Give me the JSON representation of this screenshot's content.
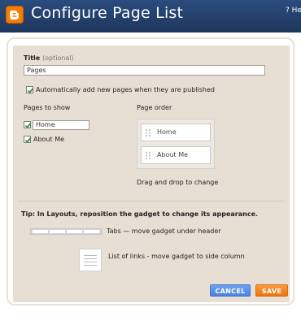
{
  "header": {
    "title": "Configure Page List",
    "help_link": "? Help"
  },
  "form": {
    "title_label": "Title",
    "title_optional": "(optional)",
    "title_value": "Pages",
    "auto_add_label": "Automatically add new pages when they are published",
    "auto_add_checked": true,
    "pages_to_show_label": "Pages to show",
    "pages_to_show": [
      {
        "label": "Home",
        "checked": true,
        "editable": true
      },
      {
        "label": "About Me",
        "checked": true,
        "editable": false
      }
    ],
    "page_order_label": "Page order",
    "page_order": [
      "Home",
      "About Me"
    ],
    "drag_hint": "Drag and drop to change"
  },
  "tip": {
    "heading": "Tip: In Layouts, reposition the gadget to change its appearance.",
    "tabs_text": "Tabs — move gadget under header",
    "list_text": "List of links - move gadget to side column"
  },
  "buttons": {
    "cancel": "CANCEL",
    "save": "SAVE"
  },
  "colors": {
    "header_bg": "#213f6a",
    "panel_bg": "#e8dfd4",
    "cancel_bg": "#5b93e8",
    "save_bg": "#f5841f",
    "logo": "#f57d00"
  },
  "icons": {
    "logo": "blogger-logo-icon",
    "grip": "drag-grip-icon",
    "check": "checkmark-icon"
  }
}
